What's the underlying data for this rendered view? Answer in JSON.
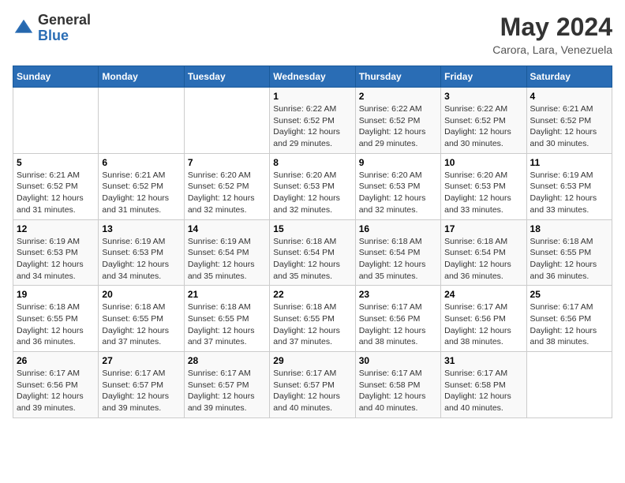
{
  "logo": {
    "general": "General",
    "blue": "Blue"
  },
  "title": "May 2024",
  "subtitle": "Carora, Lara, Venezuela",
  "days_header": [
    "Sunday",
    "Monday",
    "Tuesday",
    "Wednesday",
    "Thursday",
    "Friday",
    "Saturday"
  ],
  "weeks": [
    [
      {
        "day": "",
        "info": ""
      },
      {
        "day": "",
        "info": ""
      },
      {
        "day": "",
        "info": ""
      },
      {
        "day": "1",
        "info": "Sunrise: 6:22 AM\nSunset: 6:52 PM\nDaylight: 12 hours and 29 minutes."
      },
      {
        "day": "2",
        "info": "Sunrise: 6:22 AM\nSunset: 6:52 PM\nDaylight: 12 hours and 29 minutes."
      },
      {
        "day": "3",
        "info": "Sunrise: 6:22 AM\nSunset: 6:52 PM\nDaylight: 12 hours and 30 minutes."
      },
      {
        "day": "4",
        "info": "Sunrise: 6:21 AM\nSunset: 6:52 PM\nDaylight: 12 hours and 30 minutes."
      }
    ],
    [
      {
        "day": "5",
        "info": "Sunrise: 6:21 AM\nSunset: 6:52 PM\nDaylight: 12 hours and 31 minutes."
      },
      {
        "day": "6",
        "info": "Sunrise: 6:21 AM\nSunset: 6:52 PM\nDaylight: 12 hours and 31 minutes."
      },
      {
        "day": "7",
        "info": "Sunrise: 6:20 AM\nSunset: 6:52 PM\nDaylight: 12 hours and 32 minutes."
      },
      {
        "day": "8",
        "info": "Sunrise: 6:20 AM\nSunset: 6:53 PM\nDaylight: 12 hours and 32 minutes."
      },
      {
        "day": "9",
        "info": "Sunrise: 6:20 AM\nSunset: 6:53 PM\nDaylight: 12 hours and 32 minutes."
      },
      {
        "day": "10",
        "info": "Sunrise: 6:20 AM\nSunset: 6:53 PM\nDaylight: 12 hours and 33 minutes."
      },
      {
        "day": "11",
        "info": "Sunrise: 6:19 AM\nSunset: 6:53 PM\nDaylight: 12 hours and 33 minutes."
      }
    ],
    [
      {
        "day": "12",
        "info": "Sunrise: 6:19 AM\nSunset: 6:53 PM\nDaylight: 12 hours and 34 minutes."
      },
      {
        "day": "13",
        "info": "Sunrise: 6:19 AM\nSunset: 6:53 PM\nDaylight: 12 hours and 34 minutes."
      },
      {
        "day": "14",
        "info": "Sunrise: 6:19 AM\nSunset: 6:54 PM\nDaylight: 12 hours and 35 minutes."
      },
      {
        "day": "15",
        "info": "Sunrise: 6:18 AM\nSunset: 6:54 PM\nDaylight: 12 hours and 35 minutes."
      },
      {
        "day": "16",
        "info": "Sunrise: 6:18 AM\nSunset: 6:54 PM\nDaylight: 12 hours and 35 minutes."
      },
      {
        "day": "17",
        "info": "Sunrise: 6:18 AM\nSunset: 6:54 PM\nDaylight: 12 hours and 36 minutes."
      },
      {
        "day": "18",
        "info": "Sunrise: 6:18 AM\nSunset: 6:55 PM\nDaylight: 12 hours and 36 minutes."
      }
    ],
    [
      {
        "day": "19",
        "info": "Sunrise: 6:18 AM\nSunset: 6:55 PM\nDaylight: 12 hours and 36 minutes."
      },
      {
        "day": "20",
        "info": "Sunrise: 6:18 AM\nSunset: 6:55 PM\nDaylight: 12 hours and 37 minutes."
      },
      {
        "day": "21",
        "info": "Sunrise: 6:18 AM\nSunset: 6:55 PM\nDaylight: 12 hours and 37 minutes."
      },
      {
        "day": "22",
        "info": "Sunrise: 6:18 AM\nSunset: 6:55 PM\nDaylight: 12 hours and 37 minutes."
      },
      {
        "day": "23",
        "info": "Sunrise: 6:17 AM\nSunset: 6:56 PM\nDaylight: 12 hours and 38 minutes."
      },
      {
        "day": "24",
        "info": "Sunrise: 6:17 AM\nSunset: 6:56 PM\nDaylight: 12 hours and 38 minutes."
      },
      {
        "day": "25",
        "info": "Sunrise: 6:17 AM\nSunset: 6:56 PM\nDaylight: 12 hours and 38 minutes."
      }
    ],
    [
      {
        "day": "26",
        "info": "Sunrise: 6:17 AM\nSunset: 6:56 PM\nDaylight: 12 hours and 39 minutes."
      },
      {
        "day": "27",
        "info": "Sunrise: 6:17 AM\nSunset: 6:57 PM\nDaylight: 12 hours and 39 minutes."
      },
      {
        "day": "28",
        "info": "Sunrise: 6:17 AM\nSunset: 6:57 PM\nDaylight: 12 hours and 39 minutes."
      },
      {
        "day": "29",
        "info": "Sunrise: 6:17 AM\nSunset: 6:57 PM\nDaylight: 12 hours and 40 minutes."
      },
      {
        "day": "30",
        "info": "Sunrise: 6:17 AM\nSunset: 6:58 PM\nDaylight: 12 hours and 40 minutes."
      },
      {
        "day": "31",
        "info": "Sunrise: 6:17 AM\nSunset: 6:58 PM\nDaylight: 12 hours and 40 minutes."
      },
      {
        "day": "",
        "info": ""
      }
    ]
  ]
}
